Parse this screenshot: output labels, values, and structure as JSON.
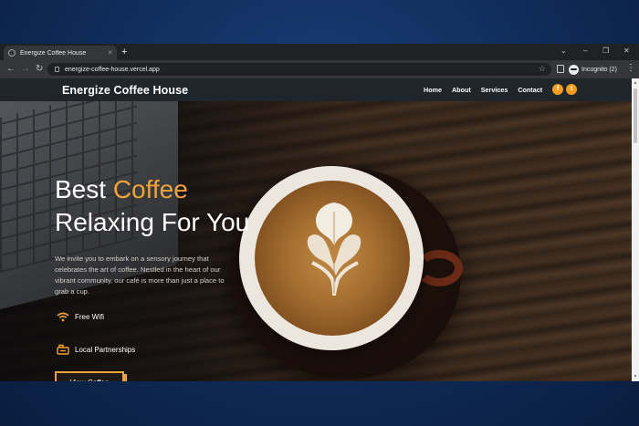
{
  "browser": {
    "tab_title": "Energize Coffee House",
    "new_tab": "+",
    "url": "energize-coffee-house.vercel.app",
    "incognito_label": "Incognito (2)",
    "tab_close": "×",
    "window_controls": {
      "collapse": "⌄",
      "minimize": "–",
      "restore": "❐",
      "close": "✕"
    },
    "nav": {
      "back": "←",
      "forward": "→",
      "reload": "↻",
      "bookmark": "☆",
      "menu": "⋮"
    },
    "scroll": {
      "up": "▲",
      "down": "▼"
    }
  },
  "site": {
    "brand": "Energize Coffee House",
    "nav_links": [
      "Home",
      "About",
      "Services",
      "Contact"
    ],
    "social_icons": [
      "facebook-icon",
      "twitter-icon"
    ],
    "social_glyphs": [
      "f",
      "t"
    ],
    "accent_color": "#f0a23a",
    "navbar_color": "#1e252b"
  },
  "hero": {
    "title_word1": "Best",
    "title_accent": "Coffee",
    "title_line2": "Relaxing For You",
    "description": "We invite you to embark on a sensory journey that celebrates the art of coffee. Nestled in the heart of our vibrant community, our café is more than just a place to grab a cup.",
    "features": [
      {
        "icon": "wifi-icon",
        "label": "Free Wifi"
      },
      {
        "icon": "partnership-icon",
        "label": "Local Partnerships"
      }
    ],
    "cta_label": "View Coffee"
  }
}
